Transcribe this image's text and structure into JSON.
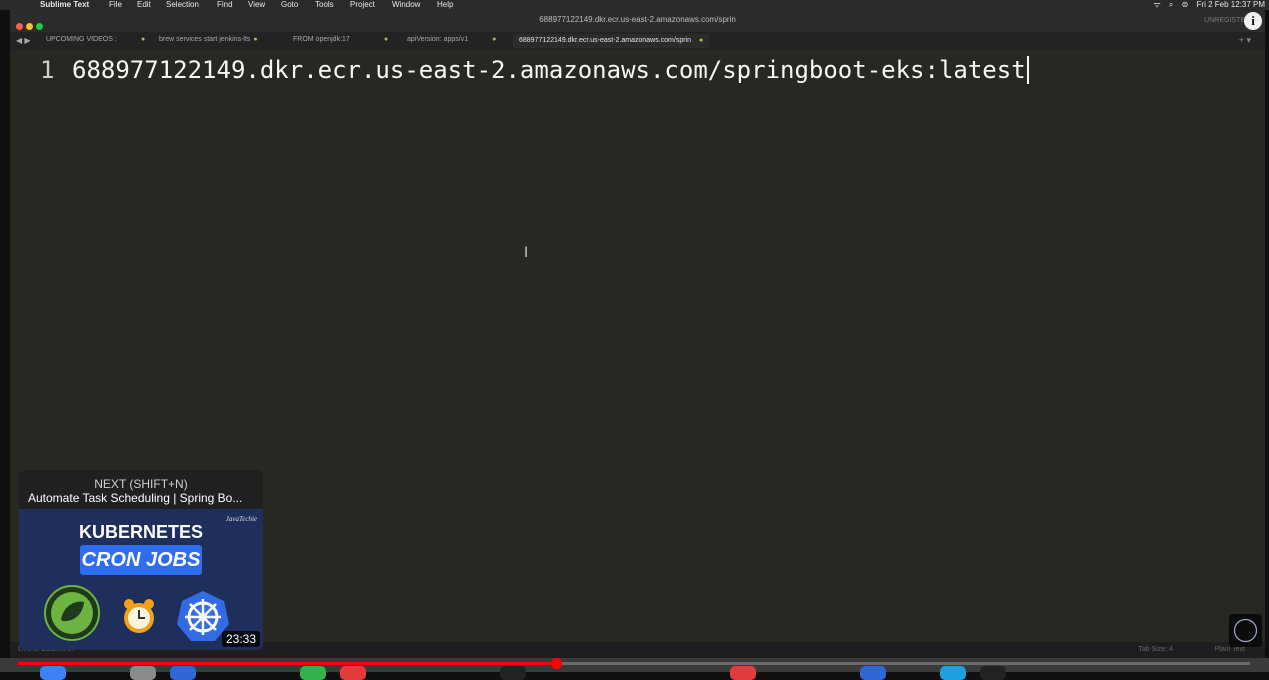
{
  "menubar": {
    "app": "Sublime Text",
    "items": [
      "File",
      "Edit",
      "Selection",
      "Find",
      "View",
      "Goto",
      "Tools",
      "Project",
      "Window",
      "Help"
    ],
    "datetime": "Fri 2 Feb  12:37 PM"
  },
  "window": {
    "title": "688977122149.dkr.ecr.us-east-2.amazonaws.com/sprin",
    "unregistered": "UNREGISTE"
  },
  "tabs": [
    {
      "label": "UPCOMING VIDEOS :",
      "active": false
    },
    {
      "label": "brew services start jenkins-lts",
      "active": false
    },
    {
      "label": "FROM openjdk:17",
      "active": false
    },
    {
      "label": "apiVersion: apps/v1",
      "active": false
    },
    {
      "label": "688977122149.dkr.ecr.us-east-2.amazonaws.com/sprin",
      "active": true
    }
  ],
  "editor": {
    "line_number": "1",
    "line_text": "688977122149.dkr.ecr.us-east-2.amazonaws.com/springboot-eks:latest",
    "cursor_glyph": "I"
  },
  "statusbar": {
    "left": "Line 1, Column 67",
    "tab_size": "Tab Size: 4",
    "syntax": "Plain Text"
  },
  "player": {
    "next_label": "NEXT (SHIFT+N)",
    "next_title": "Automate Task Scheduling | Spring Bo...",
    "thumb_brand": "JavaTechie",
    "thumb_title_1": "KUBERNETES",
    "thumb_title_2": "CRON JOBS",
    "duration": "23:33",
    "progress": 0.437
  },
  "icons": {
    "info": "i",
    "tab_nav": "◀ ▶",
    "tab_new": "+ ▾"
  },
  "colors": {
    "editor_bg": "#272822",
    "progress": "#ff0000",
    "kubernetes_blue": "#326ce5",
    "spring_green": "#6db33f"
  }
}
